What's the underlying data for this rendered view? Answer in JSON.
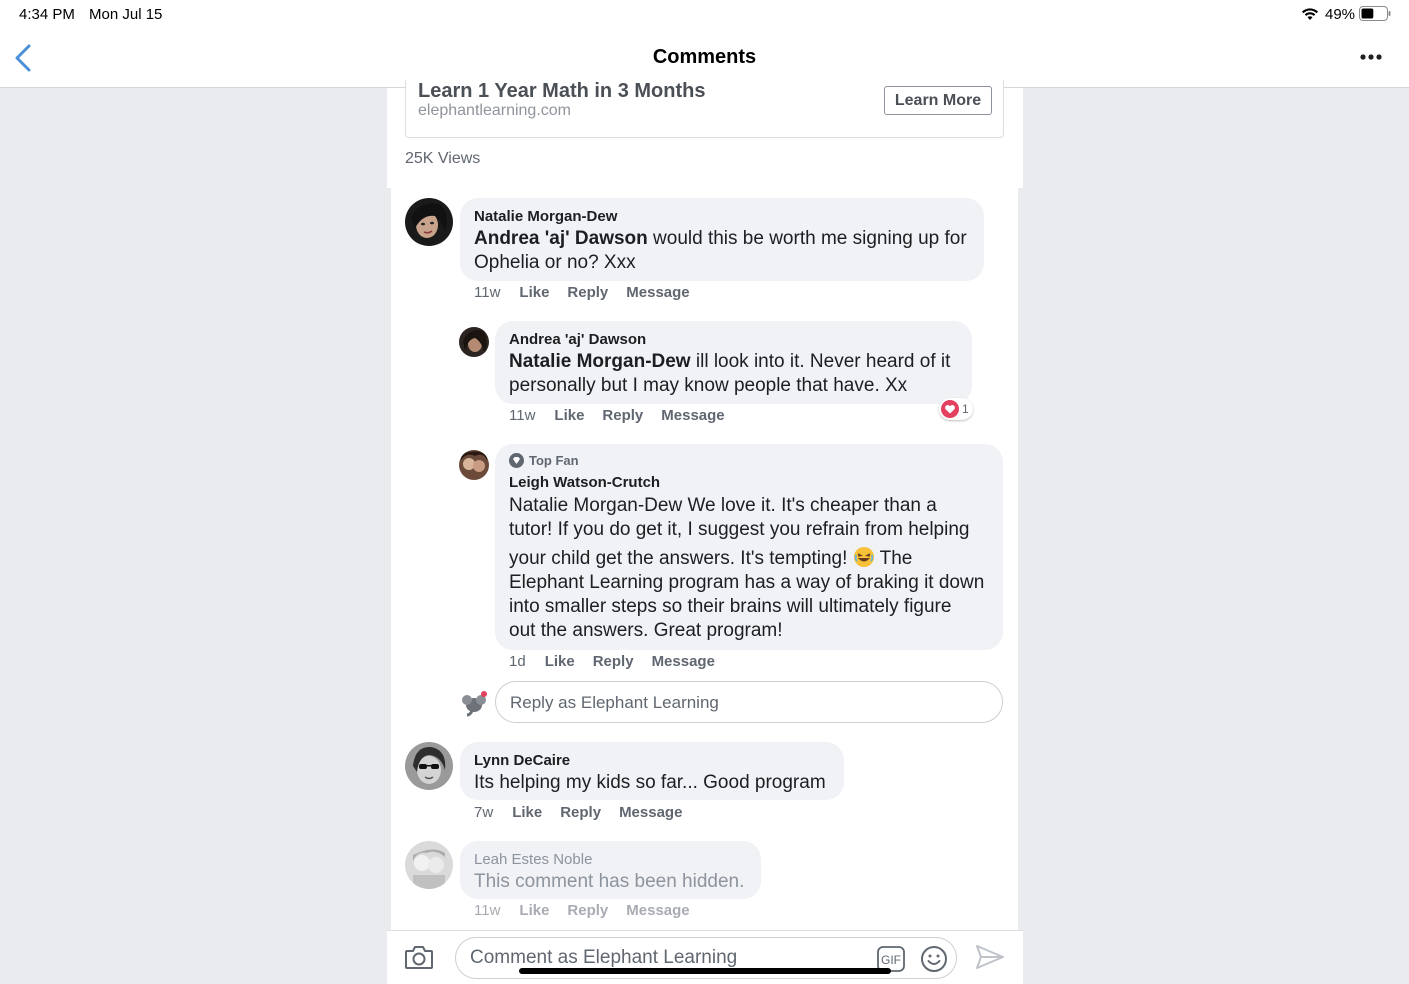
{
  "status_bar": {
    "time": "4:34 PM",
    "date": "Mon Jul 15",
    "battery": "49%",
    "battery_level": 0.49
  },
  "nav": {
    "title": "Comments",
    "back_icon": "chevron-left-icon",
    "more_icon": "more-horizontal-icon"
  },
  "ad": {
    "title": "Learn 1 Year Math in 3 Months",
    "domain": "elephantlearning.com",
    "cta_label": "Learn More"
  },
  "post": {
    "views": "25K Views"
  },
  "comments": [
    {
      "author": "Natalie Morgan-Dew",
      "mention": "Andrea 'aj' Dawson",
      "text_line1": " would this be worth me signing up for",
      "text_line2": "Ophelia or no? Xxx",
      "time": "11w",
      "like": "Like",
      "reply": "Reply",
      "message": "Message",
      "replies": [
        {
          "author": "Andrea 'aj' Dawson",
          "mention": "Natalie Morgan-Dew",
          "text_line1": " ill look into it. Never heard of it",
          "text_line2": "personally but I may know people that have. Xx",
          "time": "11w",
          "like": "Like",
          "reply": "Reply",
          "message": "Message",
          "reaction_count": "1",
          "reaction_icon": "heart-icon"
        },
        {
          "badge": "Top Fan",
          "author": "Leigh Watson-Crutch",
          "lines": [
            "Natalie Morgan-Dew We love it. It's cheaper than a",
            "tutor! If you do get it, I suggest you refrain from helping",
            "your child get the answers. It's tempting!",
            " The",
            "Elephant Learning program has a way of braking it down",
            "into smaller steps so their brains will ultimately figure",
            "out the answers. Great program!"
          ],
          "emoji": "laughing-emoji",
          "time": "1d",
          "like": "Like",
          "reply": "Reply",
          "message": "Message"
        }
      ],
      "reply_placeholder": "Reply as Elephant Learning"
    },
    {
      "author": "Lynn DeCaire",
      "text": "Its helping my kids so far... Good program",
      "time": "7w",
      "like": "Like",
      "reply": "Reply",
      "message": "Message"
    },
    {
      "author": "Leah Estes Noble",
      "text": "This comment has been hidden.",
      "time": "11w",
      "like": "Like",
      "reply": "Reply",
      "message": "Message"
    }
  ],
  "composer": {
    "placeholder": "Comment as Elephant Learning",
    "camera_icon": "camera-icon",
    "gif_icon": "gif-icon",
    "emoji_icon": "smiley-icon",
    "send_icon": "send-icon"
  },
  "colors": {
    "accent": "#4a90d9",
    "bubble": "#f0f2f5",
    "background": "#e9ebee",
    "reaction_heart": "#e4405f"
  }
}
